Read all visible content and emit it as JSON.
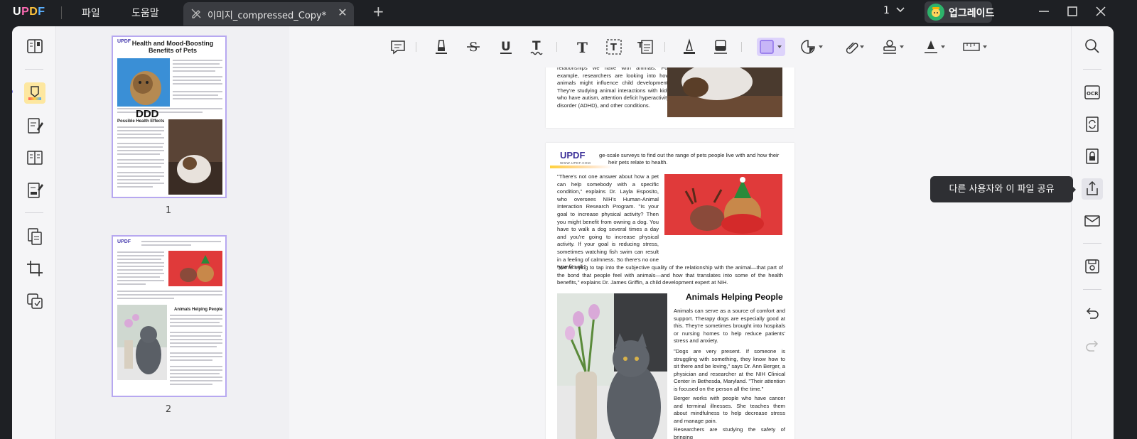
{
  "app": {
    "logo": {
      "u": "U",
      "p": "P",
      "d": "D",
      "f": "F"
    },
    "menu": {
      "file": "파일",
      "help": "도움말"
    },
    "tab": {
      "title": "이미지_compressed_Copy*",
      "close_glyph": "✕",
      "add_glyph": "+"
    },
    "page_indicator": "1",
    "upgrade_label": "업그레이드"
  },
  "thumbnails": {
    "page1": {
      "number": "1",
      "logo": "UPDF",
      "title": "Health and Mood-Boosting Benefits of Pets",
      "overlay_text": "DDD",
      "heading": "Possible Health Effects"
    },
    "page2": {
      "number": "2",
      "logo": "UPDF",
      "heading": "Animals Helping People"
    }
  },
  "document": {
    "page_top": {
      "paragraph": "relationships we have with animals. For example, researchers are looking into how animals might influence child development. They're studying animal interactions with kids who have autism, attention deficit hyperactivity disorder (ADHD), and other conditions."
    },
    "page_main": {
      "watermark": {
        "brand": "UPDF",
        "url": "WWW.UPDF.COM"
      },
      "intro": "ge-scale surveys to find out the range of pets people live with and how their",
      "intro2": "heir pets relate to health.",
      "quote1": "\"There's not one answer about how a pet can help somebody with a specific condition,\" explains Dr. Layla Esposito, who oversees NIH's Human-Animal Interaction Research Program. \"Is your goal to increase physical activity? Then you might benefit from owning a dog. You have to walk a dog several times a day and you're going to increase physical activity. If your goal is reducing stress, sometimes watching fish swim can result in a feeling of calmness. So there's no one type fits all.\"",
      "quote2": "\"We're trying to tap into the subjective quality of the relationship with the animal—that part of the bond that people feel with animals—and how that translates into some of the health benefits,\" explains Dr. James Griffin, a child development expert at NIH.",
      "section_title": "Animals Helping People",
      "section_p1": "Animals can serve as a source of comfort and support. Therapy dogs are especially good at this. They're sometimes brought into hospitals or nursing homes to help reduce patients' stress and anxiety.",
      "section_p2": "\"Dogs are very present. If someone is struggling with something, they know how to sit there and be loving,\" says Dr. Ann Berger, a physician and researcher at the NIH Clinical Center in Bethesda, Maryland. \"Their attention is focused on the person all the time.\"",
      "section_p3": "Berger works with people who have cancer and terminal illnesses. She teaches them about mindfulness to help decrease stress and manage pain.",
      "section_p4": "Researchers are studying the safety of bringing"
    }
  },
  "tooltip": {
    "share": "다른 사용자와 이 파일 공유"
  },
  "colors": {
    "accent": "#6b6bd6",
    "highlight_active": "#fde7a0",
    "tool_active": "#ddd3fb",
    "thumb_border": "#b7a8f0"
  }
}
